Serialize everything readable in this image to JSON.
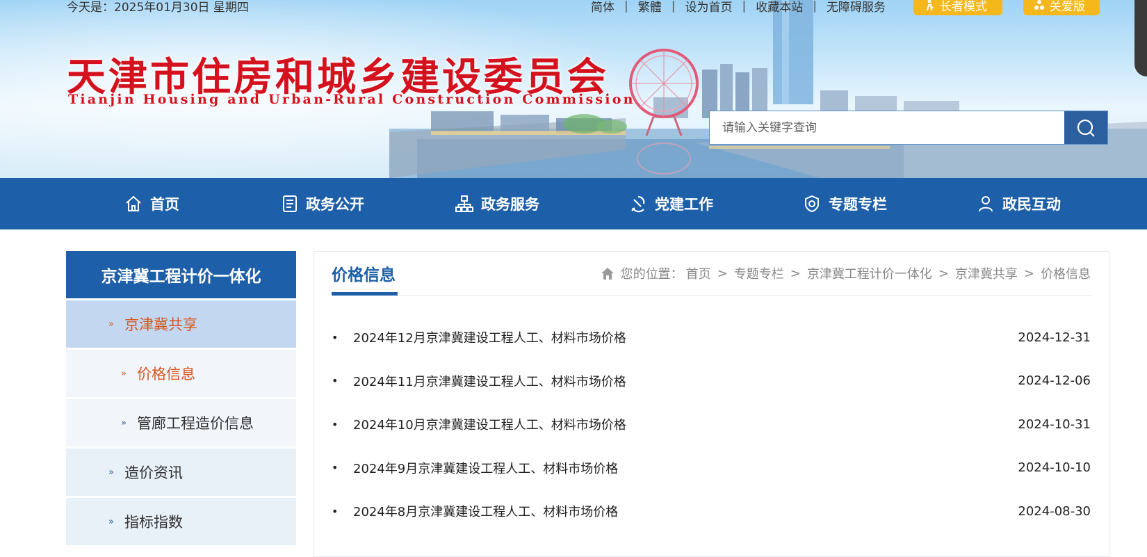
{
  "header": {
    "date_text": "今天是：2025年01月30日 星期四",
    "links": [
      "简体",
      "繁體",
      "设为首页",
      "收藏本站",
      "无障碍服务"
    ],
    "elder_mode_label": "长者模式",
    "care_mode_label": "关爱版",
    "logo_cn": "天津市住房和城乡建设委员会",
    "logo_en": "Tianjin Housing and Urban-Rural Construction Commission",
    "search_placeholder": "请输入关键字查询",
    "accent_color": "#1d5fa8",
    "logo_color": "#d4121e",
    "pill_color": "#f4b81c"
  },
  "nav": {
    "items": [
      {
        "label": "首页",
        "icon": "home-icon"
      },
      {
        "label": "政务公开",
        "icon": "document-icon"
      },
      {
        "label": "政务服务",
        "icon": "org-chart-icon"
      },
      {
        "label": "党建工作",
        "icon": "party-emblem-icon"
      },
      {
        "label": "专题专栏",
        "icon": "badge-icon"
      },
      {
        "label": "政民互动",
        "icon": "user-icon"
      }
    ]
  },
  "sidebar": {
    "title": "京津冀工程计价一体化",
    "items": [
      {
        "label": "京津冀共享",
        "level": 1,
        "state": "active"
      },
      {
        "label": "价格信息",
        "level": 2,
        "state": "current"
      },
      {
        "label": "管廊工程造价信息",
        "level": 2,
        "state": "normal"
      },
      {
        "label": "造价资讯",
        "level": 1,
        "state": "normal"
      },
      {
        "label": "指标指数",
        "level": 1,
        "state": "normal"
      }
    ]
  },
  "main": {
    "title": "价格信息",
    "breadcrumb": {
      "prefix": "您的位置：",
      "items": [
        "首页",
        "专题专栏",
        "京津冀工程计价一体化",
        "京津冀共享",
        "价格信息"
      ],
      "separator": ">"
    },
    "list": [
      {
        "title": "2024年12月京津冀建设工程人工、材料市场价格",
        "date": "2024-12-31"
      },
      {
        "title": "2024年11月京津冀建设工程人工、材料市场价格",
        "date": "2024-12-06"
      },
      {
        "title": "2024年10月京津冀建设工程人工、材料市场价格",
        "date": "2024-10-31"
      },
      {
        "title": "2024年9月京津冀建设工程人工、材料市场价格",
        "date": "2024-10-10"
      },
      {
        "title": "2024年8月京津冀建设工程人工、材料市场价格",
        "date": "2024-08-30"
      }
    ]
  }
}
